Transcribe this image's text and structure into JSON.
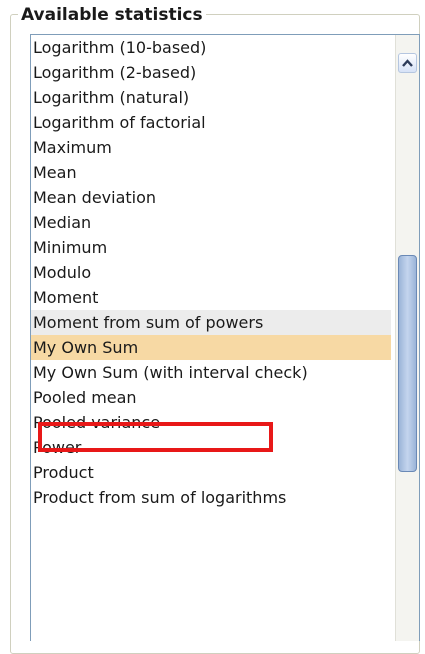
{
  "panel": {
    "title": "Available statistics"
  },
  "list": {
    "items": [
      "Logarithm (10-based)",
      "Logarithm (2-based)",
      "Logarithm (natural)",
      "Logarithm of factorial",
      "Maximum",
      "Mean",
      "Mean deviation",
      "Median",
      "Minimum",
      "Modulo",
      "Moment",
      "Moment from sum of powers",
      "My Own Sum",
      "My Own Sum (with interval check)",
      "Pooled mean",
      "Pooled variance",
      "Power",
      "Product",
      "Product from sum of logarithms"
    ],
    "selected": "My Own Sum",
    "hovered": "Moment from sum of powers"
  },
  "scrollbar": {
    "up_icon": "chevron-up-icon"
  },
  "colors": {
    "selected_bg": "#f7d9a4",
    "highlight_border": "#e81818",
    "thumb": "#9bb4d8"
  }
}
